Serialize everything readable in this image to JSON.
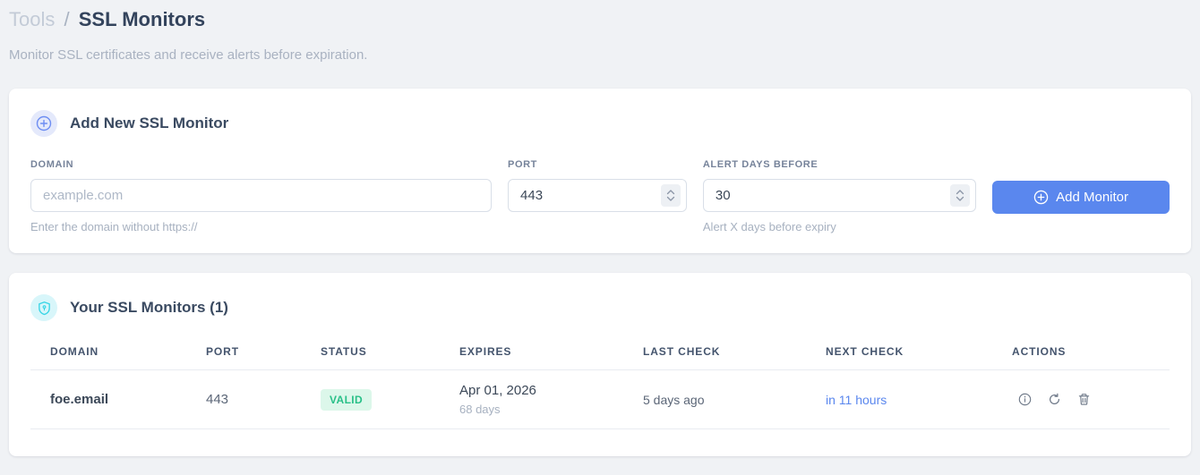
{
  "breadcrumb": {
    "section": "Tools",
    "separator": "/",
    "current": "SSL Monitors"
  },
  "subtitle": "Monitor SSL certificates and receive alerts before expiration.",
  "add_card": {
    "title": "Add New SSL Monitor",
    "icon": "circle-plus-icon",
    "domain_field": {
      "label": "DOMAIN",
      "placeholder": "example.com",
      "helper": "Enter the domain without https://"
    },
    "port_field": {
      "label": "PORT",
      "value": "443"
    },
    "alert_field": {
      "label": "ALERT DAYS BEFORE",
      "value": "30",
      "helper": "Alert X days before expiry"
    },
    "submit_label": "Add Monitor"
  },
  "monitors_card": {
    "title": "Your SSL Monitors (1)",
    "icon": "shield-icon",
    "headers": [
      "DOMAIN",
      "PORT",
      "STATUS",
      "EXPIRES",
      "LAST CHECK",
      "NEXT CHECK",
      "ACTIONS"
    ],
    "rows": [
      {
        "domain": "foe.email",
        "port": "443",
        "status": "VALID",
        "expires_date": "Apr 01, 2026",
        "expires_days": "68 days",
        "last_check": "5 days ago",
        "next_check": "in 11 hours",
        "actions": [
          "info-icon",
          "refresh-icon",
          "trash-icon"
        ]
      }
    ]
  },
  "colors": {
    "accent_blue": "#5a87ee",
    "badge_green_text": "#29c088",
    "badge_green_bg": "#dcf7ea",
    "shield_cyan": "#38d5e6",
    "page_background": "#f0f2f5"
  }
}
